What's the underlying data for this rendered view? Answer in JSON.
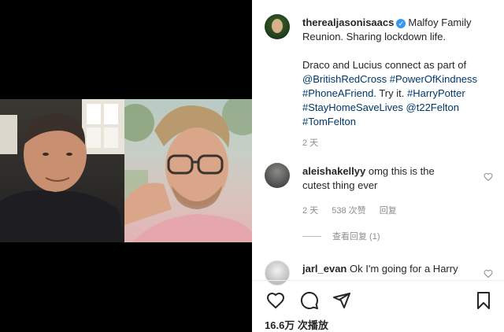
{
  "post": {
    "username": "therealjasonisaacs",
    "caption_line1": "Malfoy Family Reunion. Sharing lockdown life.",
    "caption_p2_text": "Draco and Lucius connect as part of",
    "hashtag_1": "@BritishRedCross",
    "hashtag_2": "#PowerOfKindness",
    "hashtag_3": "#PhoneAFriend.",
    "caption_try": "Try it.",
    "hashtag_4": "#HarryPotter",
    "hashtag_5": "#StayHomeSaveLives",
    "mention": "@t22Felton",
    "hashtag_6": "#TomFelton",
    "timestamp": "2 天"
  },
  "comments": [
    {
      "username": "aleishakellyy",
      "text": "omg this is the cutest thing ever",
      "time": "2 天",
      "likes": "538 次赞",
      "reply": "回复"
    },
    {
      "username": "jarl_evan",
      "text": "Ok I'm going for a Harry"
    }
  ],
  "view_replies": "查看回复 (1)",
  "views": "16.6万 次播放",
  "icons": [
    "heart-icon",
    "comment-icon",
    "share-icon",
    "bookmark-icon",
    "verified-badge-icon"
  ],
  "colors": {
    "link": "#00376b",
    "verified": "#3897f0",
    "muted": "#8e8e8e"
  }
}
